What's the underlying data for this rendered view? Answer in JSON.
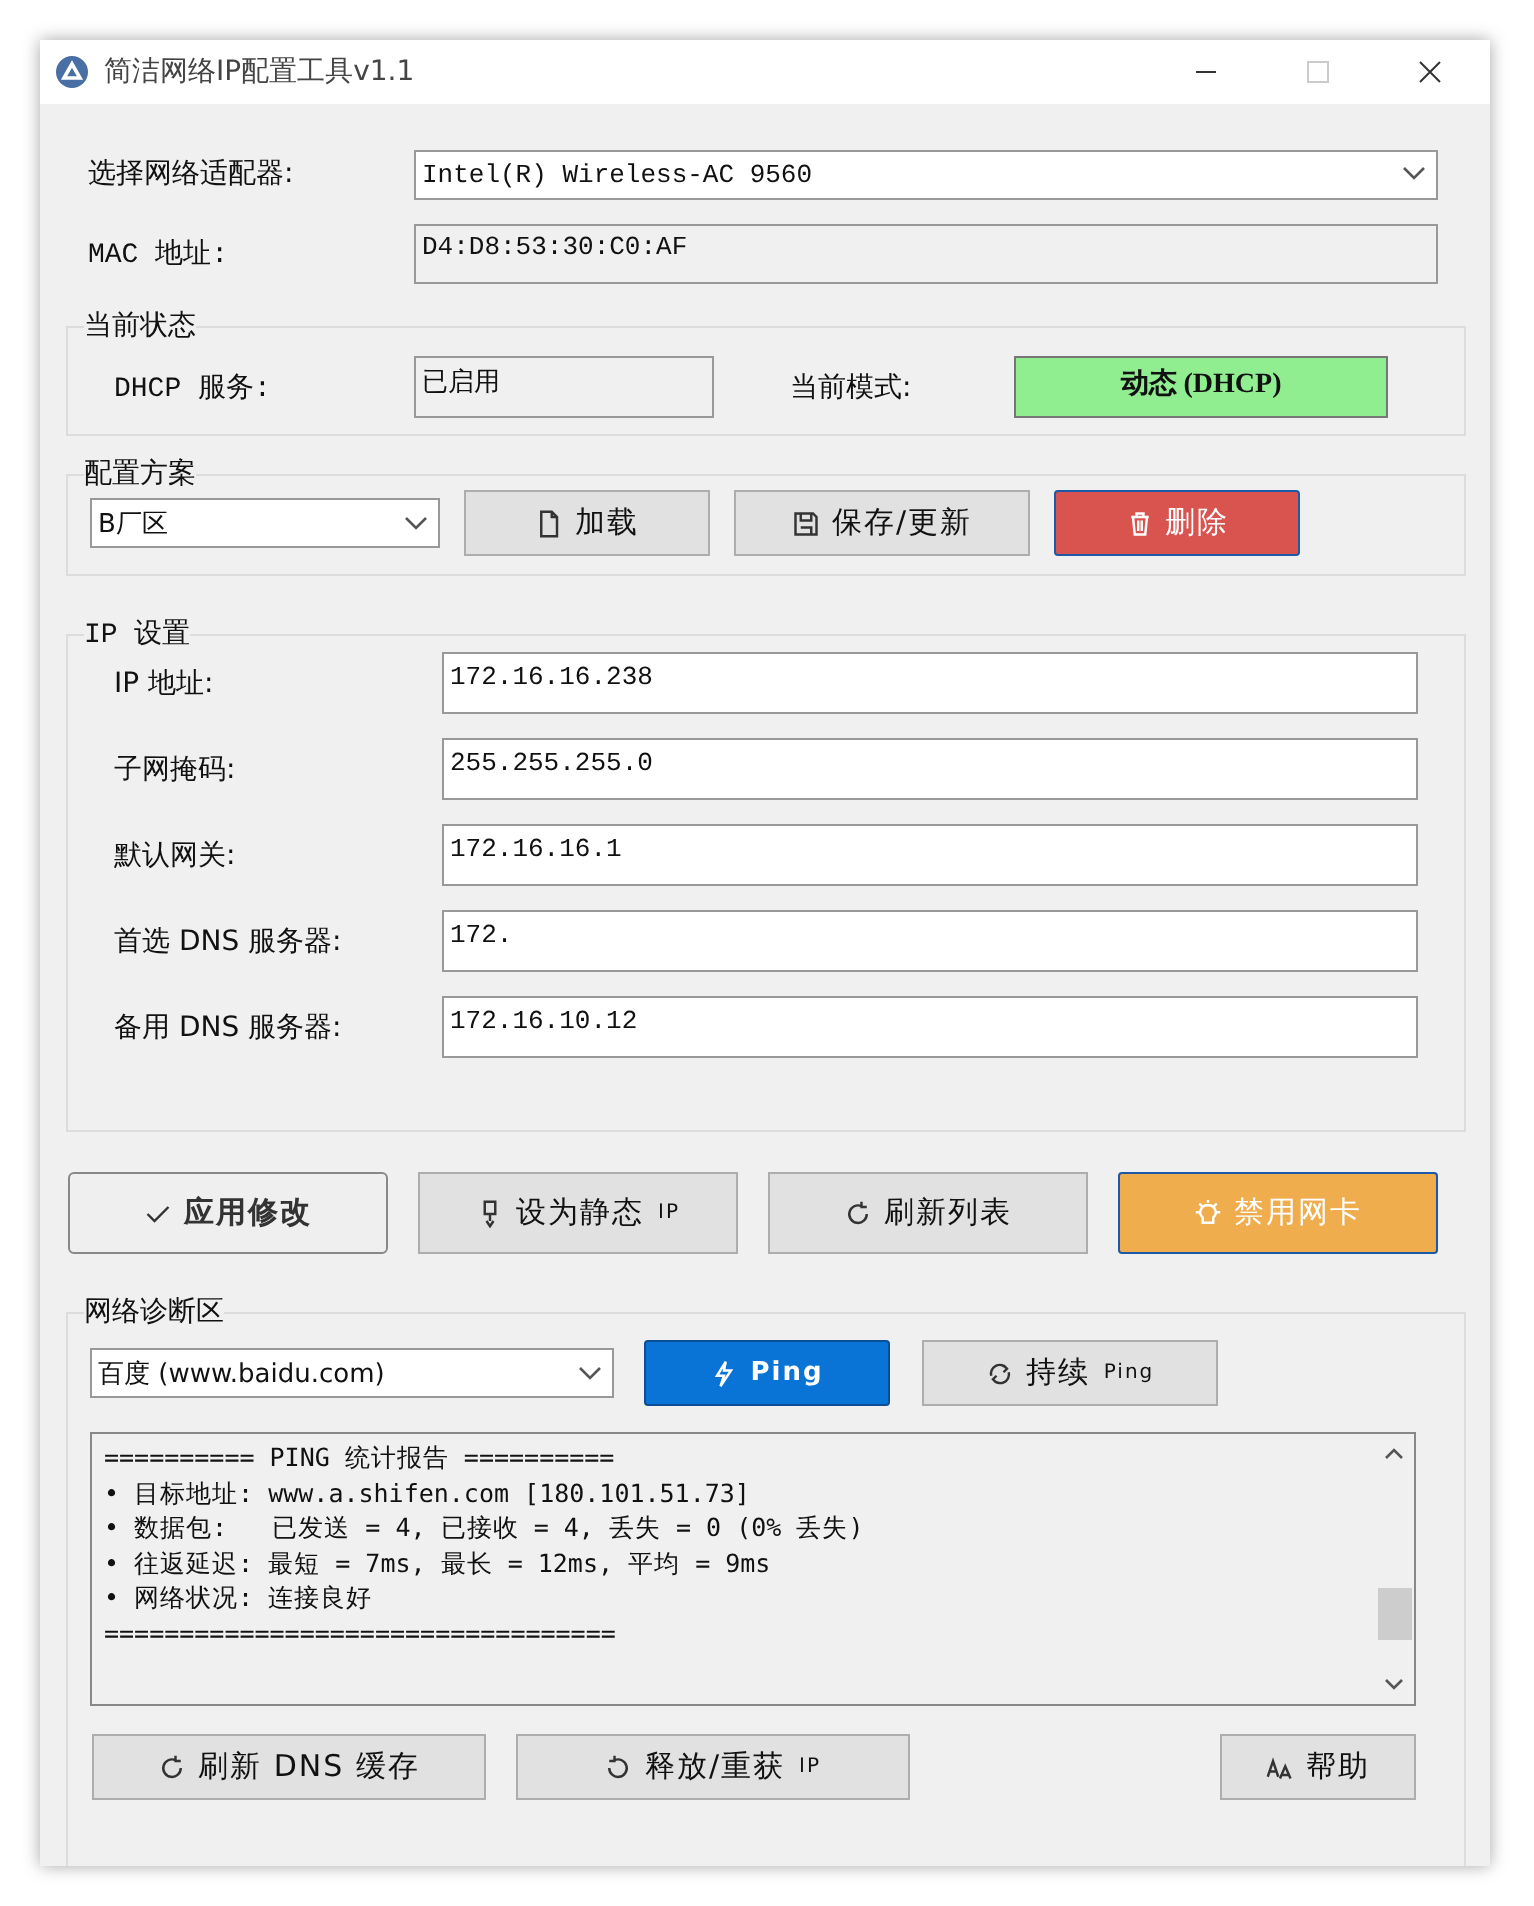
{
  "window": {
    "title": "简洁网络IP配置工具v1.1"
  },
  "adapter": {
    "label": "选择网络适配器:",
    "value": "Intel(R) Wireless-AC 9560"
  },
  "mac": {
    "label": "MAC 地址:",
    "value": "D4:D8:53:30:C0:AF"
  },
  "status": {
    "title": "当前状态",
    "dhcp_label": "DHCP 服务:",
    "dhcp_value": "已启用",
    "mode_label": "当前模式:",
    "mode_value": "动态 (DHCP)"
  },
  "profiles": {
    "title": "配置方案",
    "value": "B厂区",
    "buttons": [
      {
        "label": "加载",
        "kind": "default"
      },
      {
        "label": "保存/更新",
        "kind": "default"
      },
      {
        "label": "删除",
        "kind": "danger"
      }
    ]
  },
  "ip_settings": {
    "title": "IP 设置",
    "fields": [
      {
        "label": "IP 地址:",
        "value": "172.16.16.238"
      },
      {
        "label": "子网掩码:",
        "value": "255.255.255.0"
      },
      {
        "label": "默认网关:",
        "value": "172.16.16.1"
      },
      {
        "label": "首选 DNS 服务器:",
        "value": "172."
      },
      {
        "label": "备用 DNS 服务器:",
        "value": "172.16.10.12"
      }
    ]
  },
  "actions": [
    {
      "label": "应用修改",
      "kind": "outline"
    },
    {
      "label": "设为静态",
      "suffix": "IP",
      "kind": "default"
    },
    {
      "label": "刷新列表",
      "kind": "default"
    },
    {
      "label": "禁用网卡",
      "kind": "warning"
    }
  ],
  "diagnostics": {
    "title": "网络诊断区",
    "target": "百度 (www.baidu.com)",
    "buttons": [
      {
        "label": "Ping",
        "kind": "primary"
      },
      {
        "label": "持续",
        "suffix": "Ping",
        "kind": "default"
      }
    ],
    "log": [
      "========== PING 统计报告 ==========",
      "• 目标地址: www.a.shifen.com [180.101.51.73]",
      "• 数据包:   已发送 = 4, 已接收 = 4, 丢失 = 0 (0% 丢失)",
      "• 往返延迟: 最短 = 7ms, 最长 = 12ms, 平均 = 9ms",
      "• 网络状况: 连接良好",
      "=================================="
    ],
    "tools": [
      {
        "label": "刷新 DNS 缓存"
      },
      {
        "label": "释放/重获",
        "suffix": "IP"
      },
      {
        "label": "帮助"
      }
    ]
  }
}
